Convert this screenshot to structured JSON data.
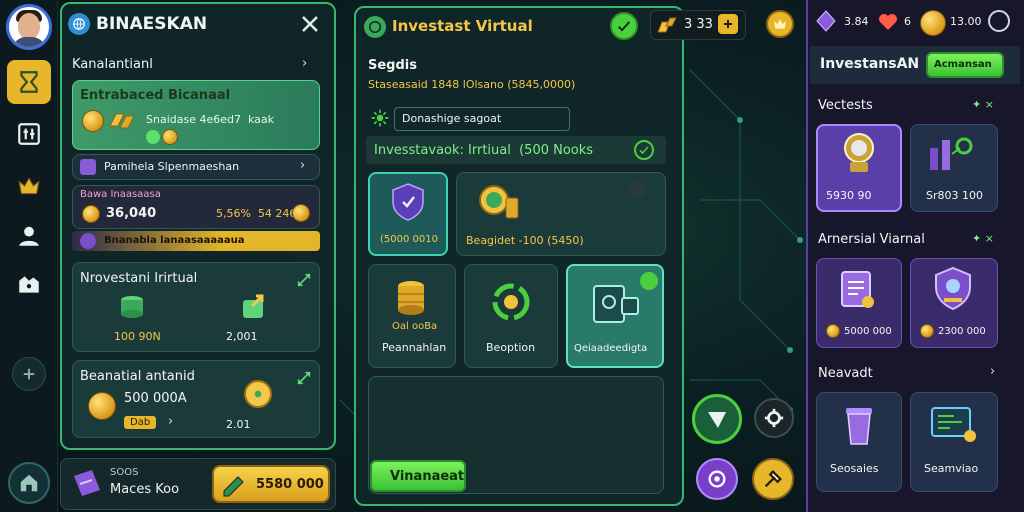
{
  "rail": {
    "items": [
      {
        "name": "sidebar-item-invest",
        "icon": "hourglass-icon",
        "active": true
      },
      {
        "name": "sidebar-item-tools",
        "icon": "tools-icon",
        "active": false
      },
      {
        "name": "sidebar-item-rewards",
        "icon": "crown-icon",
        "active": false
      },
      {
        "name": "sidebar-item-profile",
        "icon": "user-icon",
        "active": false
      },
      {
        "name": "sidebar-item-map",
        "icon": "map-icon",
        "active": false
      },
      {
        "name": "sidebar-item-more",
        "icon": "plus-circle-icon",
        "active": false
      }
    ]
  },
  "left_panel": {
    "title": "BINAESKAN",
    "section_header": "Kanalantianl",
    "promo": {
      "title": "Entrabaced Bicanaal",
      "subtitle": "Snaidase 4e6ed7  kaak"
    },
    "row1": "Pamihela Slpenmaeshan",
    "row2": {
      "label": "Bawa Inaasaasa",
      "value_left": "36,040",
      "value_right": "5,56%  54 2460"
    },
    "row3_banner": "Bnanabla lanaasaaaaaua",
    "card1": {
      "title": "Nrovestani Irirtual",
      "value_left": "100 90N",
      "value_right": "2,001"
    },
    "card2": {
      "title": "Beanatial antanid",
      "value_left": "500 000A",
      "small_badge": "Dab",
      "value_right": "2.01"
    },
    "bottom": {
      "label_small": "SOOS",
      "label": "Maces Koo",
      "button": "5580 000"
    }
  },
  "center_panel": {
    "title": "Investast Virtual",
    "subtitle": "Segdis",
    "subline": "Staseasaid 1848 lOlsano (5845,0000)",
    "search_value": "Donashige sagoat",
    "banner": "Invesstavaok: Irrtiual  (500 Nooks",
    "tiles": [
      {
        "label": "(5000 0010",
        "icon": "shield-icon",
        "selected": true
      },
      {
        "label": "Beagidet -100 (5450)",
        "icon": "coin-stack-icon",
        "selected": false
      }
    ],
    "tiles2": [
      {
        "caption": "Oal ooBa",
        "label": "Peannahlan",
        "icon": "barrel-icon",
        "selected": false
      },
      {
        "label": "Beoption",
        "icon": "recycle-icon",
        "selected": false
      },
      {
        "label": "Qeiaadeedigta",
        "icon": "document-icon",
        "selected": true
      }
    ],
    "action_button": "Vinanaeat"
  },
  "top_bar": {
    "center_counter": "3 33",
    "right_panel_counters": {
      "gems": "3.84",
      "hearts": "6",
      "coins": "13.00"
    }
  },
  "right_panel": {
    "header_title": "InvestansAN",
    "header_button": "Acmansan",
    "sections": [
      {
        "title": "Vectests",
        "items": [
          {
            "label": "5930 90",
            "icon": "robot-icon",
            "selected": true
          },
          {
            "label": "Sr803 100",
            "icon": "network-icon",
            "selected": false
          }
        ]
      },
      {
        "title": "Arnersial Viarnal",
        "items": [
          {
            "label": "5000 000",
            "icon": "clipboard-icon",
            "selected": false
          },
          {
            "label": "2300 000",
            "icon": "shield-badge-icon",
            "selected": false
          }
        ]
      },
      {
        "title": "Neavadt",
        "items": [
          {
            "label": "Seosaies",
            "icon": "cup-icon",
            "selected": false
          },
          {
            "label": "Seamviao",
            "icon": "monitor-icon",
            "selected": false
          }
        ]
      }
    ]
  },
  "colors": {
    "accent_green": "#37b86f",
    "gold": "#e7b62a",
    "purple": "#7a4fc9",
    "background": "#0b1f22"
  }
}
